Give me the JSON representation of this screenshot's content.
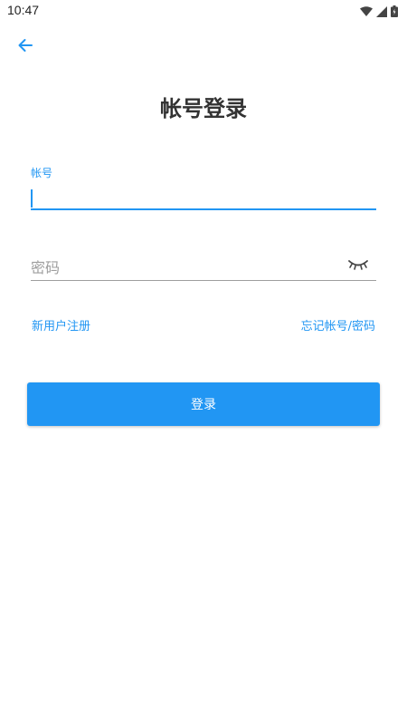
{
  "status_bar": {
    "time": "10:47",
    "icons": [
      "wifi-icon",
      "cell-signal-icon",
      "battery-icon"
    ]
  },
  "header": {
    "back_icon": "arrow-left-icon",
    "title": "帐号登录"
  },
  "form": {
    "account": {
      "label": "帐号",
      "value": ""
    },
    "password": {
      "placeholder": "密码",
      "toggle_icon": "eye-closed-icon"
    }
  },
  "links": {
    "register": "新用户注册",
    "forgot": "忘记帐号/密码"
  },
  "login_button": {
    "label": "登录"
  },
  "colors": {
    "accent": "#2196F3",
    "title": "#333333",
    "placeholder": "#9E9E9E",
    "background": "#FFFFFF"
  }
}
